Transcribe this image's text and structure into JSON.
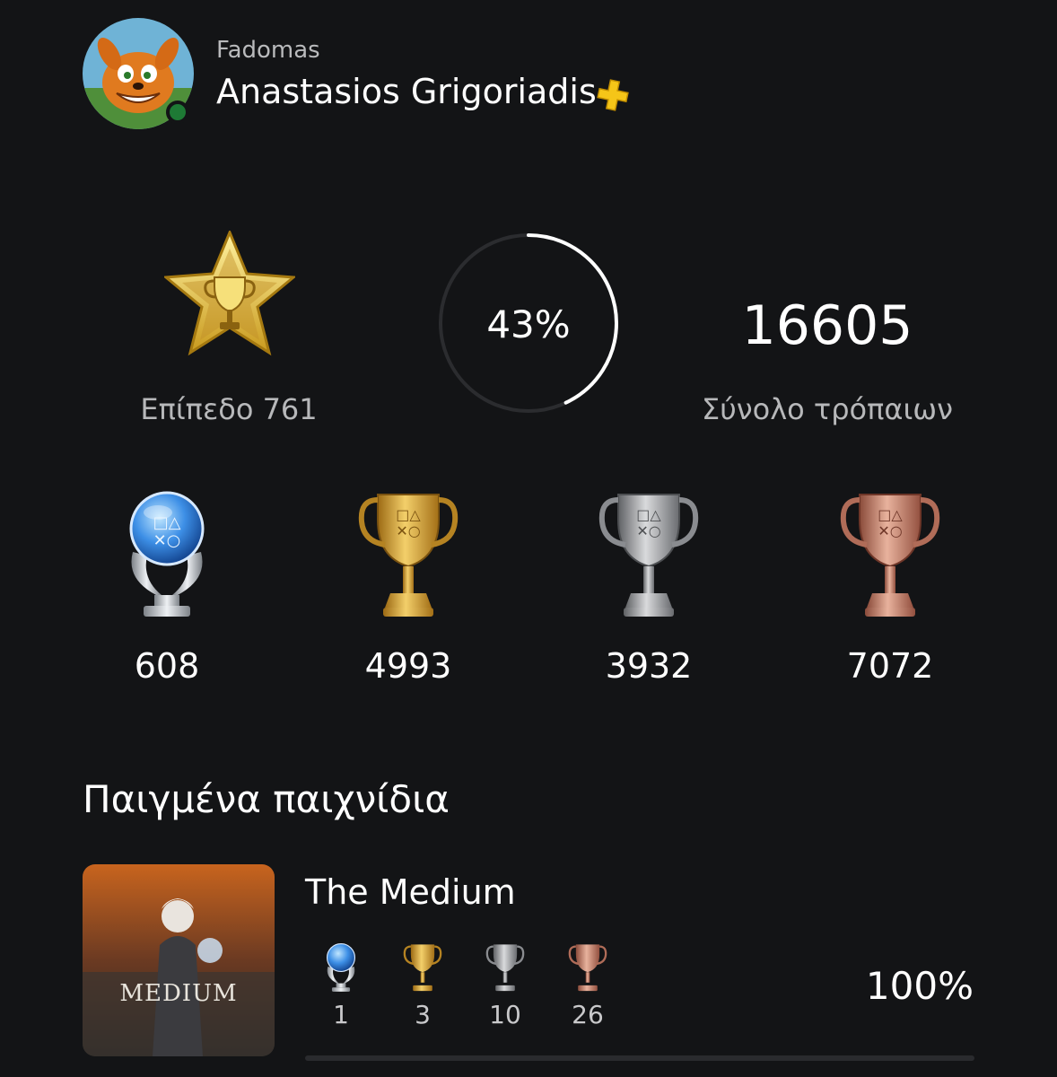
{
  "profile": {
    "online_id": "Fadomas",
    "real_name": "Anastasios Grigoriadis",
    "status": "online",
    "has_plus": true,
    "avatar_icon": "crash-bandicoot-avatar",
    "plus_icon": "playstation-plus-icon"
  },
  "summary": {
    "level_label": "Επίπεδο 761",
    "progress_text": "43%",
    "progress_fraction": 0.43,
    "total_trophies": "16605",
    "total_label": "Σύνολο τρόπαιων"
  },
  "trophy_counts": {
    "platinum": "608",
    "gold": "4993",
    "silver": "3932",
    "bronze": "7072"
  },
  "games_section": {
    "title": "Παιγμένα παιχνίδια",
    "games": [
      {
        "title": "The Medium",
        "cover_text": "MEDIUM",
        "platinum": "1",
        "gold": "3",
        "silver": "10",
        "bronze": "26",
        "progress": "100%",
        "progress_fraction": 1.0
      }
    ]
  },
  "colors": {
    "background": "#131416",
    "online_status": "#1e7a35",
    "plus_yellow": "#f5c518",
    "gold": "#d9a534",
    "silver": "#a8aaad",
    "bronze": "#c8846b",
    "platinum_blue": "#3a8fe0"
  }
}
